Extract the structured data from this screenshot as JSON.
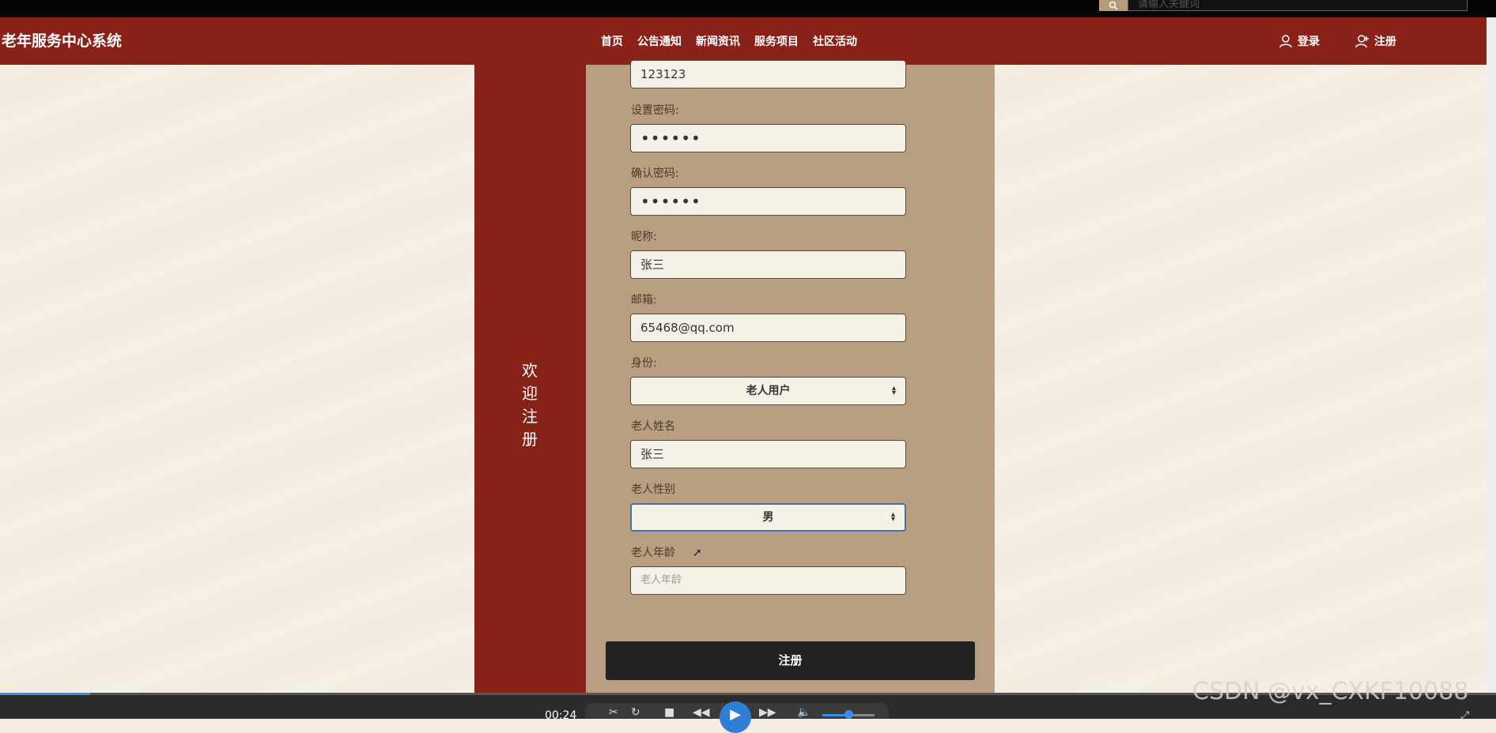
{
  "header": {
    "search_placeholder": "请输入关键词",
    "brand": "老年服务中心系统",
    "nav": [
      "首页",
      "公告通知",
      "新闻资讯",
      "服务项目",
      "社区活动"
    ],
    "login_label": "登录",
    "register_label": "注册"
  },
  "sidebar": {
    "welcome": "欢迎注册"
  },
  "form": {
    "account_value": "123123",
    "password_label": "设置密码:",
    "password_value": "••••••",
    "confirm_label": "确认密码:",
    "confirm_value": "••••••",
    "nickname_label": "昵称:",
    "nickname_value": "张三",
    "email_label": "邮箱:",
    "email_value": "65468@qq.com",
    "role_label": "身份:",
    "role_value": "老人用户",
    "elder_name_label": "老人姓名",
    "elder_name_value": "张三",
    "elder_gender_label": "老人性别",
    "elder_gender_value": "男",
    "elder_age_label": "老人年龄",
    "elder_age_placeholder": "老人年龄",
    "submit_label": "注册"
  },
  "player": {
    "time": "00:24",
    "progress": 0.06,
    "volume": 0.5
  },
  "watermark": "CSDN @vx_CXKF10088",
  "colors": {
    "nav_bg": "#8a221a",
    "panel_bg": "#b99f81",
    "button_bg": "#222222",
    "page_bg": "#f4ece0"
  }
}
